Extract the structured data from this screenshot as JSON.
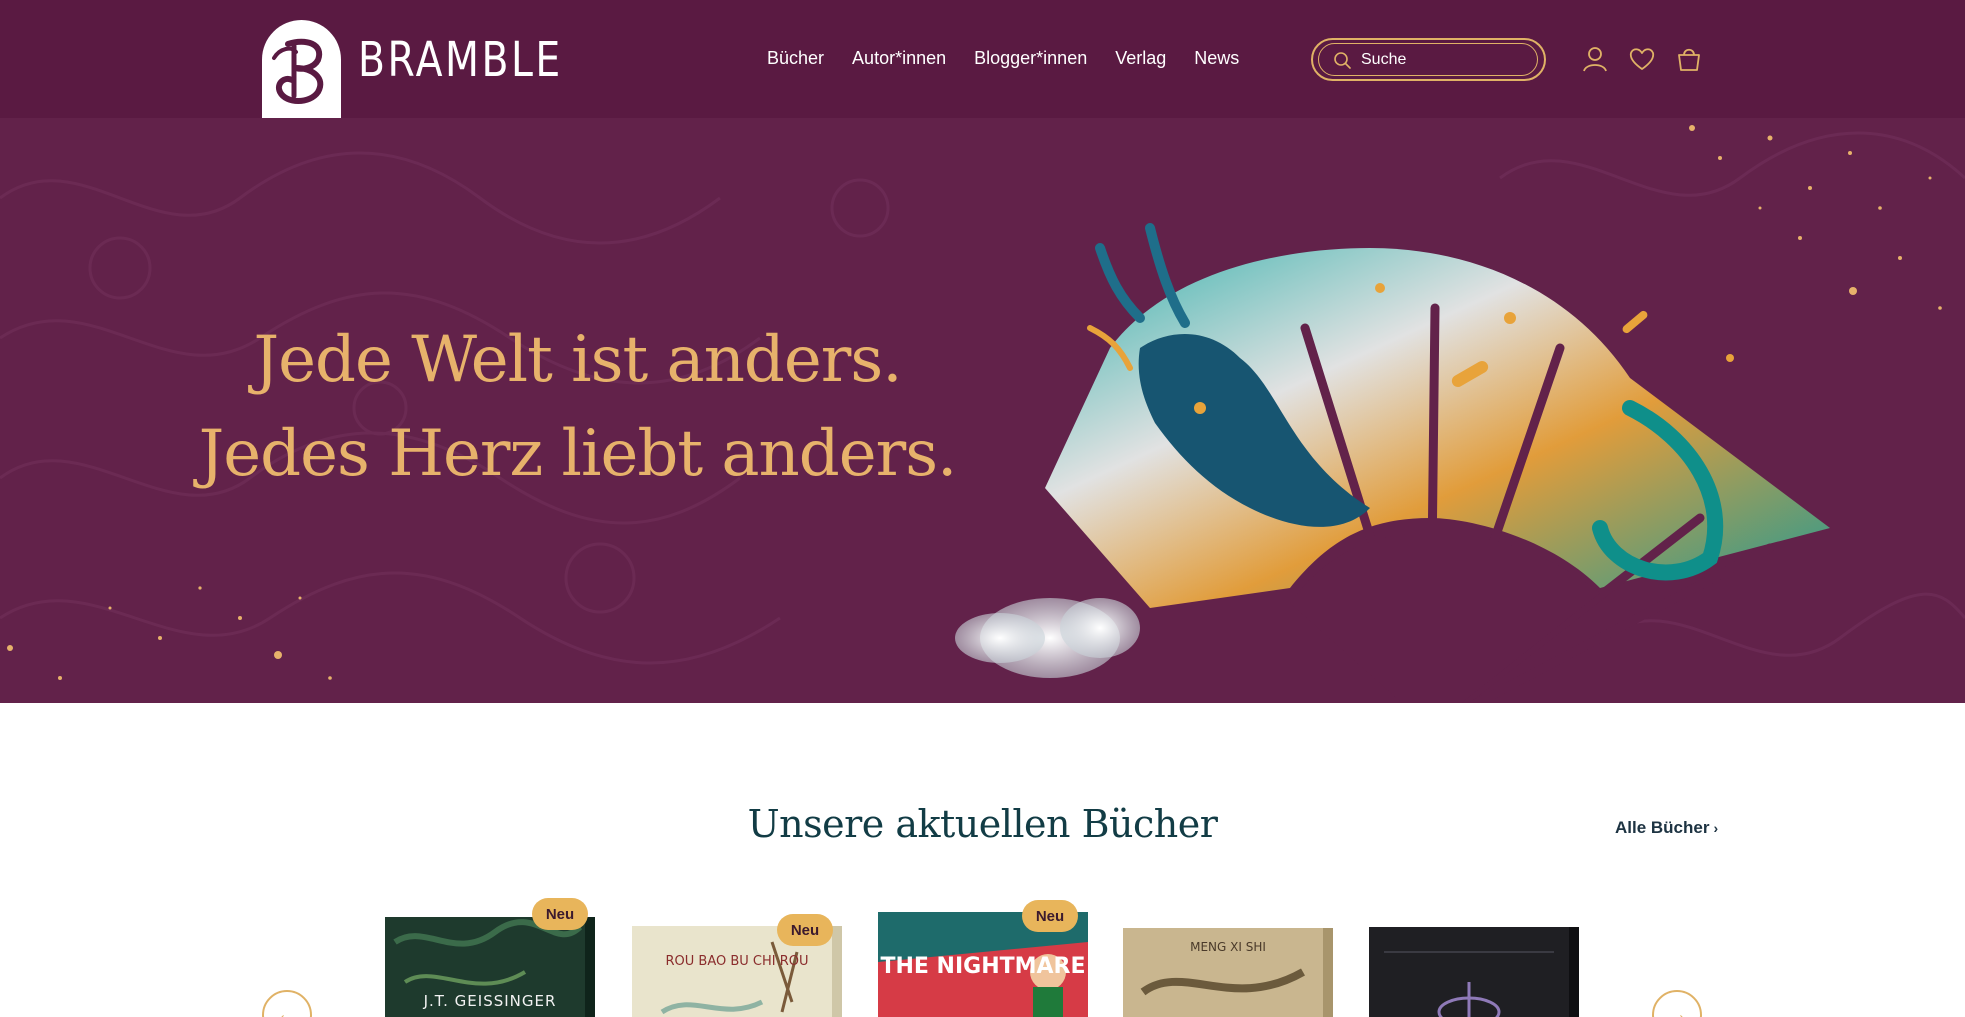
{
  "header": {
    "brand": "BRAMBLE",
    "nav": [
      {
        "label": "Bücher"
      },
      {
        "label": "Autor*innen"
      },
      {
        "label": "Blogger*innen"
      },
      {
        "label": "Verlag"
      },
      {
        "label": "News"
      }
    ],
    "search": {
      "placeholder": "Suche",
      "icon": "search-icon"
    },
    "icons": [
      "user-icon",
      "heart-icon",
      "shopping-bag-icon"
    ]
  },
  "hero": {
    "line1": "Jede Welt ist anders.",
    "line2": "Jedes Herz liebt anders."
  },
  "main": {
    "section_title": "Unsere aktuellen Bücher",
    "all_books_label": "Alle Bücher",
    "books": [
      {
        "badge": "Neu",
        "cover_text": "J.T. GEISSINGER"
      },
      {
        "badge": "Neu",
        "cover_text": "ROU BAO BU CHI ROU"
      },
      {
        "badge": "Neu",
        "cover_text": "THE NIGHTMARE"
      },
      {
        "badge": "",
        "cover_text": "MENG XI SHI"
      },
      {
        "badge": "",
        "cover_text": ""
      }
    ]
  },
  "colors": {
    "header_bg": "#5a1a42",
    "hero_bg": "#62224a",
    "accent_gold": "#e0b266",
    "title_teal": "#123c45"
  }
}
